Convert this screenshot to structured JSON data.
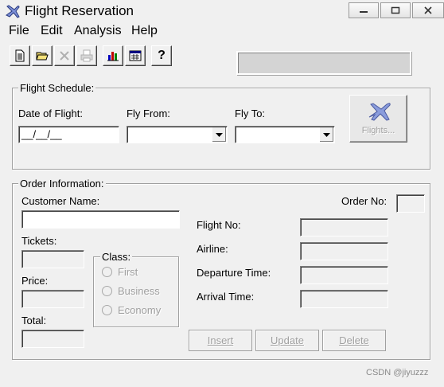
{
  "window": {
    "title": "Flight Reservation"
  },
  "menu": {
    "items": [
      "File",
      "Edit",
      "Analysis",
      "Help"
    ]
  },
  "toolbar": {
    "buttons": [
      {
        "icon": "new-document-icon",
        "enabled": true
      },
      {
        "icon": "open-folder-icon",
        "enabled": true
      },
      {
        "icon": "delete-icon",
        "enabled": false
      },
      {
        "icon": "print-icon",
        "enabled": false
      },
      {
        "icon": "bar-chart-icon",
        "enabled": true
      },
      {
        "icon": "calendar-icon",
        "enabled": true
      },
      {
        "icon": "help-icon",
        "enabled": true
      }
    ],
    "help_glyph": "?"
  },
  "flight_schedule": {
    "legend": "Flight Schedule:",
    "date_label": "Date of Flight:",
    "date_value": "__/__/__",
    "fly_from_label": "Fly From:",
    "fly_from_value": "",
    "fly_to_label": "Fly To:",
    "fly_to_value": "",
    "flights_button": "Flights..."
  },
  "order_information": {
    "legend": "Order Information:",
    "customer_name_label": "Customer Name:",
    "customer_name_value": "",
    "order_no_label": "Order No:",
    "order_no_value": "",
    "tickets_label": "Tickets:",
    "price_label": "Price:",
    "total_label": "Total:",
    "class_legend": "Class:",
    "class_options": [
      "First",
      "Business",
      "Economy"
    ],
    "flight_no_label": "Flight No:",
    "airline_label": "Airline:",
    "departure_time_label": "Departure Time:",
    "arrival_time_label": "Arrival Time:"
  },
  "actions": {
    "insert": "Insert",
    "update": "Update",
    "delete": "Delete"
  },
  "watermark": "CSDN @jiyuzzz",
  "colors": {
    "background": "#f0f0f0",
    "disabled_text": "#a0a0a0",
    "airplane_blue": "#7b8fd6"
  }
}
